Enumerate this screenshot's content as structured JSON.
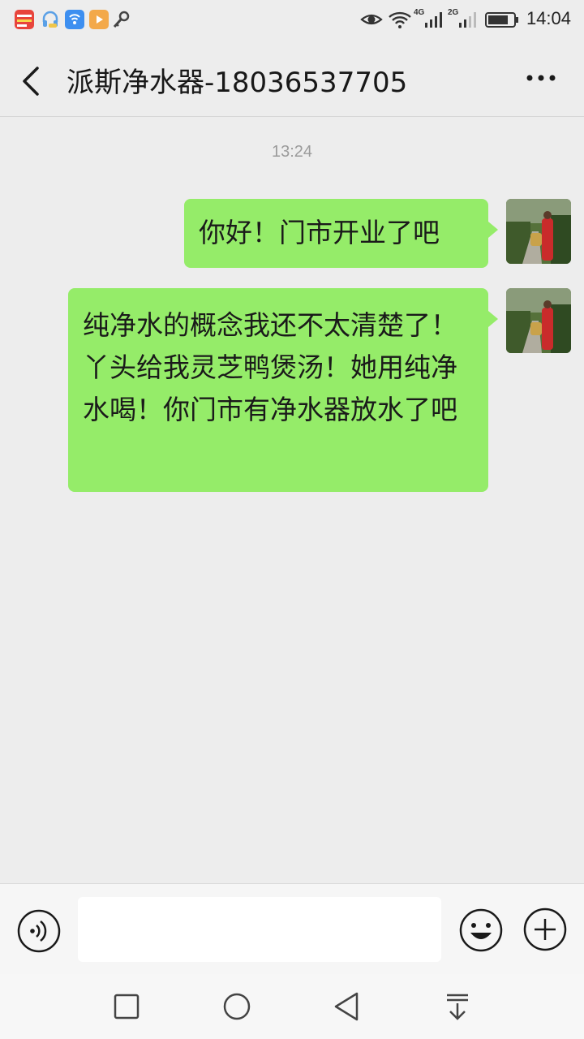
{
  "status_bar": {
    "time": "14:04",
    "network_1": "4G",
    "network_2": "2G",
    "icons": [
      "news-app-icon",
      "headset-app-icon",
      "wifi-hotspot-app-icon",
      "video-app-icon",
      "key-icon",
      "eye-icon",
      "wifi-icon",
      "signal-icon",
      "battery-icon"
    ]
  },
  "header": {
    "title": "派斯净水器-18036537705"
  },
  "chat": {
    "timestamp": "13:24",
    "messages": [
      {
        "sender": "me",
        "text": "你好！门市开业了吧"
      },
      {
        "sender": "me",
        "text": "纯净水的概念我还不太清楚了！丫头给我灵芝鸭煲汤！她用纯净水喝！你门市有净水器放水了吧"
      }
    ],
    "bubble_color": "#95ec69"
  },
  "input_bar": {
    "value": "",
    "placeholder": ""
  },
  "nav_bar": {
    "buttons": [
      "recent-apps",
      "home",
      "back",
      "notifications"
    ]
  }
}
